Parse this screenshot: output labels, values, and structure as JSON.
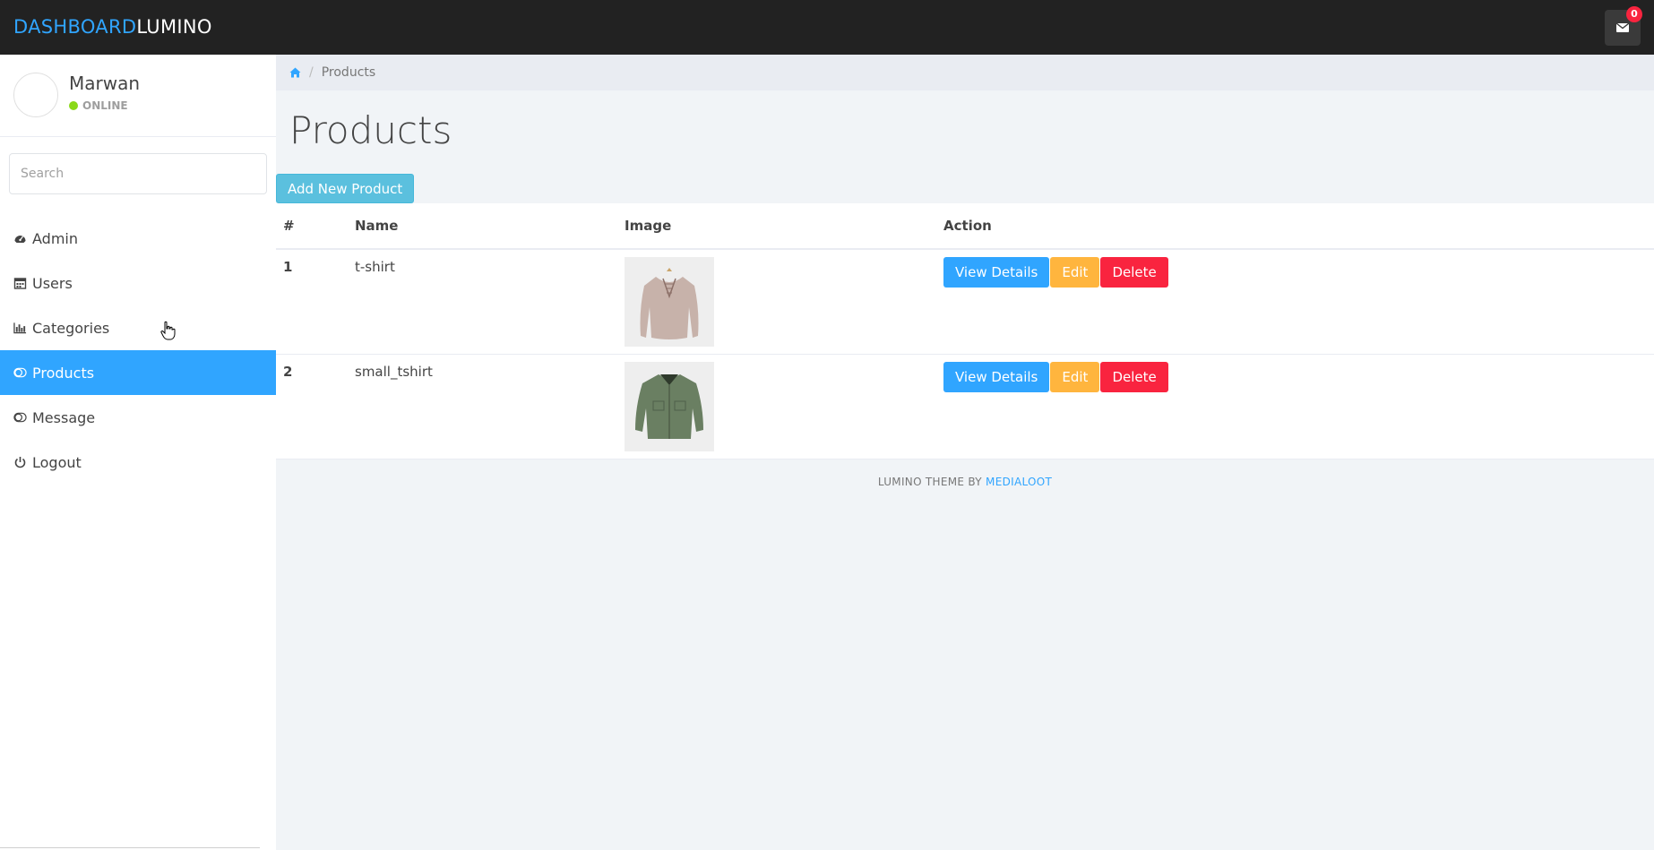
{
  "navbar": {
    "brand_prefix": "DASHBOARD",
    "brand_suffix": "LUMINO",
    "message_count": "0",
    "colors": {
      "background": "#222222",
      "accent": "#30a5ff",
      "badge": "#f9243f"
    }
  },
  "sidebar": {
    "profile": {
      "name": "Marwan",
      "status": "ONLINE"
    },
    "search": {
      "placeholder": "Search",
      "value": ""
    },
    "items": [
      {
        "label": "Admin",
        "icon": "dashboard-icon",
        "active": false
      },
      {
        "label": "Users",
        "icon": "calendar-icon",
        "active": false
      },
      {
        "label": "Categories",
        "icon": "bar-chart-icon",
        "active": false
      },
      {
        "label": "Products",
        "icon": "toggle-icon",
        "active": true
      },
      {
        "label": "Message",
        "icon": "toggle-icon",
        "active": false
      },
      {
        "label": "Logout",
        "icon": "power-icon",
        "active": false
      }
    ]
  },
  "breadcrumb": {
    "home_icon": "home-icon",
    "current": "Products"
  },
  "main": {
    "title": "Products",
    "add_button": "Add New Product"
  },
  "table": {
    "headers": [
      "#",
      "Name",
      "Image",
      "Action"
    ],
    "rows": [
      {
        "num": "1",
        "name": "t-shirt",
        "image": "beige-sweater-image"
      },
      {
        "num": "2",
        "name": "small_tshirt",
        "image": "green-jacket-image"
      }
    ],
    "actions": {
      "view": "View Details",
      "edit": "Edit",
      "delete": "Delete"
    }
  },
  "footer": {
    "text": "LUMINO THEME BY",
    "link": "MEDIALOOT"
  }
}
